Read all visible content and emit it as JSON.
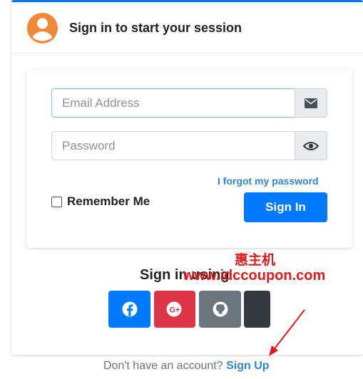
{
  "header": {
    "title": "Sign in to start your session"
  },
  "form": {
    "email_placeholder": "Email Address",
    "password_placeholder": "Password",
    "forgot_link": "I forgot my password",
    "remember_label": "Remember Me",
    "signin_button": "Sign In"
  },
  "social": {
    "heading": "Sign in using",
    "buttons": [
      "facebook-icon",
      "google-plus-icon",
      "github-icon",
      "dark-icon"
    ]
  },
  "footer": {
    "prompt": "Don't have an account?",
    "signup_link": "Sign Up"
  },
  "watermark": {
    "chinese": "惠主机",
    "url": "www.idccoupon.com"
  },
  "colors": {
    "primary": "#007bff",
    "danger": "#dc3545",
    "secondary": "#6c757d",
    "dark": "#343a40",
    "avatar": "#f0883a",
    "link": "#2f86d6",
    "annotation": "#e01b1b"
  }
}
